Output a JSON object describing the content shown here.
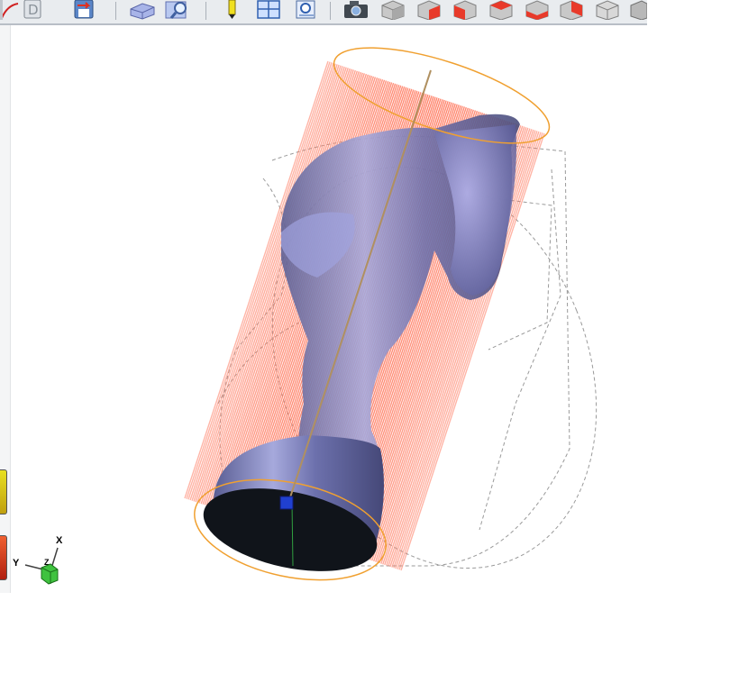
{
  "toolbar": {
    "items": [
      {
        "icon": "sketch-curve-icon"
      },
      {
        "icon": "document-d-icon"
      },
      {
        "icon": "save-model-icon"
      },
      {
        "icon": "stock-block-icon"
      },
      {
        "icon": "measure-inspect-icon"
      },
      {
        "icon": "tool-pencil-icon"
      },
      {
        "icon": "grid-view-icon"
      },
      {
        "icon": "search-report-icon"
      },
      {
        "icon": "camera-snapshot-icon"
      },
      {
        "icon": "view-iso-icon"
      },
      {
        "icon": "view-front-icon"
      },
      {
        "icon": "view-back-icon"
      },
      {
        "icon": "view-left-icon"
      },
      {
        "icon": "view-right-icon"
      },
      {
        "icon": "view-top-icon"
      },
      {
        "icon": "view-bottom-icon"
      },
      {
        "icon": "view-wire-icon"
      }
    ]
  },
  "viewport": {
    "model": "chess-knight",
    "toolpath_color": "#ff7a60",
    "model_color": "#8a90c8",
    "stock_color": "#f0a030"
  },
  "triad": {
    "x_label": "X",
    "y_label": "Y",
    "z_label": "Z",
    "cube_color": "#3fc23f"
  }
}
